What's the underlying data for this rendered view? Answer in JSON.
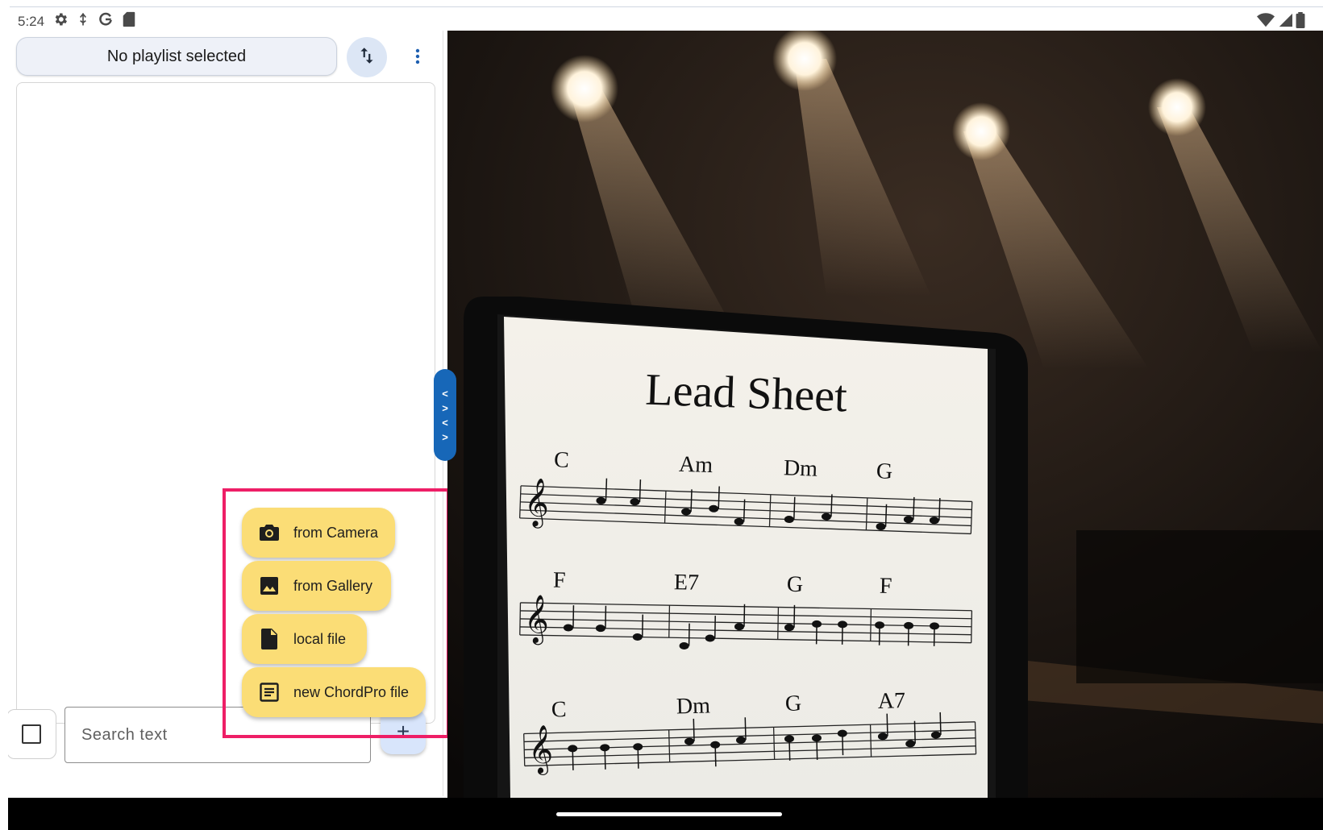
{
  "status_bar": {
    "time": "5:24",
    "icons": [
      "gear-icon",
      "usb-icon",
      "google-icon",
      "sd-card-icon"
    ],
    "right_icons": [
      "wifi-icon",
      "signal-icon",
      "battery-icon"
    ]
  },
  "left_panel": {
    "playlist_label": "No playlist selected",
    "sort_icon": "swap-vertical-icon",
    "more_icon": "more-vert-icon",
    "search_placeholder": "Search text",
    "add_label": "+"
  },
  "speed_dial": {
    "items": [
      {
        "label": "from Camera",
        "icon": "camera-icon"
      },
      {
        "label": "from Gallery",
        "icon": "image-icon"
      },
      {
        "label": "local file",
        "icon": "file-icon"
      },
      {
        "label": "new ChordPro file",
        "icon": "article-icon"
      }
    ],
    "highlight_color": "#ee1e66",
    "button_color": "#fbdd76"
  },
  "drawer_handle": {
    "glyphs": [
      "<",
      ">",
      "<",
      ">"
    ],
    "color": "#1767b8"
  },
  "hero": {
    "sheet_title": "Lead Sheet",
    "chords_row1": [
      "C",
      "Am",
      "Dm",
      "G"
    ],
    "chords_row2": [
      "F",
      "E7",
      "G",
      "F"
    ],
    "chords_row3": [
      "C",
      "Dm",
      "G",
      "A7"
    ]
  }
}
